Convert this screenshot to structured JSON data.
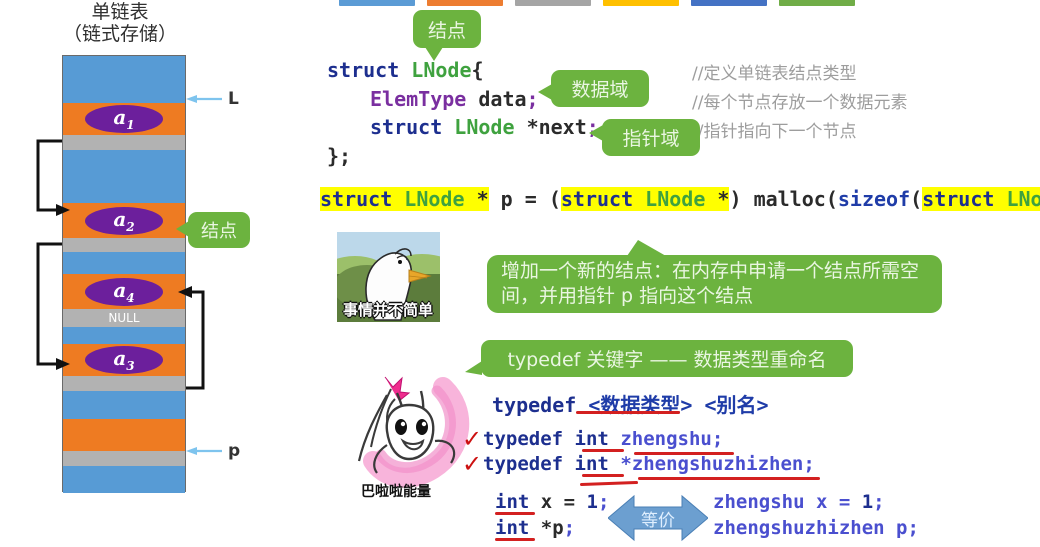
{
  "top_bars": [
    {
      "color": "#5b9bd5"
    },
    {
      "color": "#ed7d31"
    },
    {
      "color": "#a5a5a5"
    },
    {
      "color": "#ffc000"
    },
    {
      "color": "#4472c4"
    },
    {
      "color": "#70ad47"
    }
  ],
  "diagram": {
    "title_line1": "单链表",
    "title_line2": "（链式存储）",
    "cells": [
      {
        "kind": "blue",
        "label": ""
      },
      {
        "kind": "orange",
        "label": "a",
        "sub": "1"
      },
      {
        "kind": "gray",
        "label": ""
      },
      {
        "kind": "blue",
        "label": ""
      },
      {
        "kind": "orange",
        "label": "a",
        "sub": "2"
      },
      {
        "kind": "gray",
        "label": ""
      },
      {
        "kind": "blue",
        "label": ""
      },
      {
        "kind": "orange",
        "label": "a",
        "sub": "4"
      },
      {
        "kind": "gray",
        "label": "NULL"
      },
      {
        "kind": "blue",
        "label": ""
      },
      {
        "kind": "orange",
        "label": "a",
        "sub": "3"
      },
      {
        "kind": "gray",
        "label": ""
      },
      {
        "kind": "blue",
        "label": ""
      },
      {
        "kind": "orange",
        "label": ""
      },
      {
        "kind": "gray",
        "label": ""
      },
      {
        "kind": "blue",
        "label": ""
      }
    ],
    "pointer_L": "L",
    "pointer_p": "p",
    "node_callout": "结点"
  },
  "callouts": {
    "node": "结点",
    "data_field": "数据域",
    "pointer_field": "指针域",
    "new_node": "增加一个新的结点：在内存中申请一个结点所需空间，并用指针 p 指向这个结点",
    "typedef_keyword": "typedef 关键字 —— 数据类型重命名"
  },
  "code": {
    "struct_line1": {
      "kw": "struct",
      "type": "LNode",
      "brace": "{"
    },
    "struct_line2": {
      "type": "ElemType",
      "name": "data",
      "semi": ";"
    },
    "struct_line3": {
      "kw": "struct",
      "type": "LNode",
      "star_name": "*next",
      "semi": ";"
    },
    "struct_line4": "};",
    "comments": [
      "//定义单链表结点类型",
      "//每个节点存放一个数据元素",
      "//指针指向下一个节点"
    ],
    "malloc_line": {
      "p1_kw": "struct",
      "p1_ty": "LNode",
      "p1_star": "*",
      "p2": " p = (",
      "p3_kw": "struct",
      "p3_ty": "LNode",
      "p3_star": "*",
      "p4": ") ",
      "p5_fn": "malloc",
      "p6": "(",
      "p7_kw": "sizeof",
      "p8": "(",
      "p9_kw": "struct",
      "p10_ty": "LNode",
      "p11": "));"
    },
    "typedef_pattern": {
      "kw": "typedef",
      "arg1": "<数据类型>",
      "arg2": "<别名>"
    },
    "typedef_examples": [
      {
        "check": "✓",
        "kw": "typedef",
        "type": "int",
        "name": "zhengshu",
        "semi": ";"
      },
      {
        "check": "✓",
        "kw": "typedef",
        "type": "int",
        "name": "*zhengshuzhizhen",
        "semi": ";"
      }
    ],
    "equiv_left": [
      {
        "type": "int",
        "rest": " x = ",
        "num": "1",
        "semi": ";"
      },
      {
        "type": "int",
        "rest": " *p",
        "num": "",
        "semi": ";"
      }
    ],
    "equiv_right": [
      {
        "text": "zhengshu x = ",
        "num": "1",
        "semi": ";"
      },
      {
        "text": "zhengshuzhizhen p",
        "num": "",
        "semi": ";"
      }
    ],
    "equiv_label": "等价"
  },
  "images": {
    "duck_caption": "事情并不简单",
    "girl_caption": "巴啦啦能量"
  }
}
